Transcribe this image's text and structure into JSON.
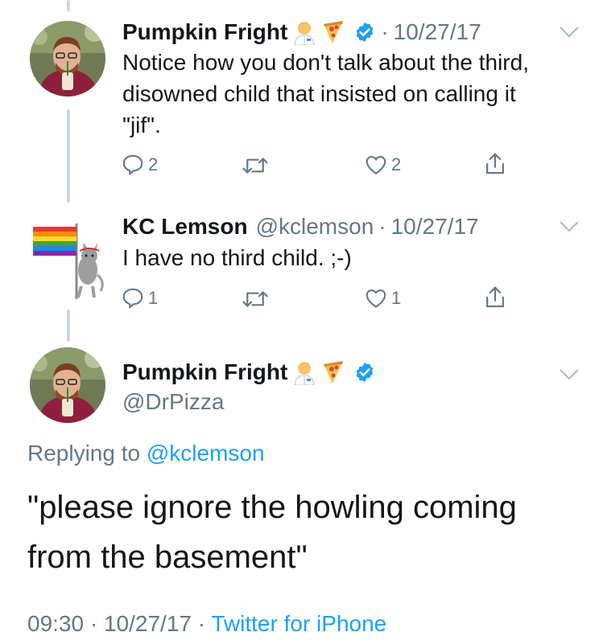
{
  "tweet1": {
    "name": "Pumpkin Fright",
    "date": "10/27/17",
    "text_line1": "Notice how you don't talk about the third,",
    "text_line2": "disowned child that insisted on calling it",
    "text_line3": "\"jif\".",
    "replies": "2",
    "likes": "2"
  },
  "tweet2": {
    "name": "KC Lemson",
    "handle": "@kclemson",
    "date": "10/27/17",
    "text": "I have no third child. ;-)",
    "replies": "1",
    "likes": "1"
  },
  "main": {
    "name": "Pumpkin Fright",
    "handle": "@DrPizza",
    "replying_prefix": "Replying to",
    "replying_to": "@kclemson",
    "text_line1": "\"please ignore the howling coming",
    "text_line2": "from the basement\"",
    "time": "09:30",
    "date": "10/27/17",
    "source": "Twitter for iPhone"
  },
  "colors": {
    "link": "#1da1f2",
    "muted": "#657786",
    "text": "#14171a",
    "thread_line": "#ccd6dd"
  }
}
